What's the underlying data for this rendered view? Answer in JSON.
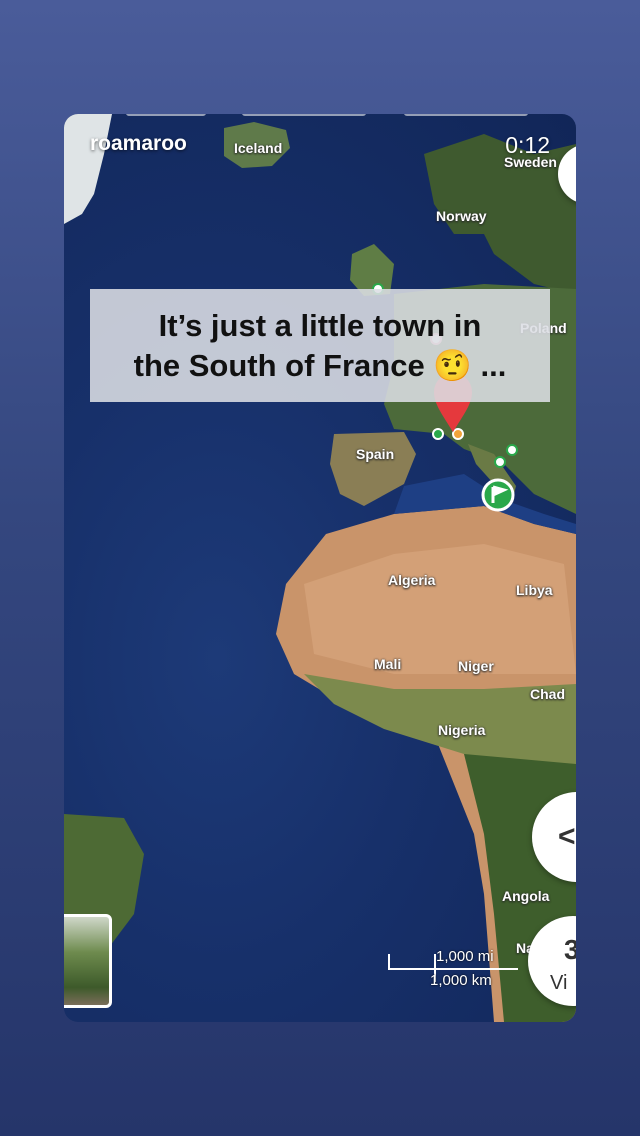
{
  "story": {
    "username": "roamaroo",
    "timestamp": "0:12",
    "caption_line1": "It’s just a little town in",
    "caption_line2": "the South of France 🤨 ..."
  },
  "map": {
    "labels": {
      "iceland": "Iceland",
      "sweden": "Sweden",
      "norway": "Norway",
      "poland": "Poland",
      "spain": "Spain",
      "algeria": "Algeria",
      "libya": "Libya",
      "mali": "Mali",
      "niger": "Niger",
      "chad": "Chad",
      "nigeria": "Nigeria",
      "angola": "Angola",
      "namibia": "Nami"
    },
    "scale": {
      "miles": "1,000 mi",
      "km": "1,000 km"
    }
  },
  "controls": {
    "share_glyph": "<",
    "view_3d_top": "3",
    "view_3d_bottom": "Vi"
  },
  "colors": {
    "ocean": "#17306a",
    "marker_red": "#e5393d",
    "marker_green": "#2aa84a",
    "marker_orange": "#f2a33a"
  }
}
